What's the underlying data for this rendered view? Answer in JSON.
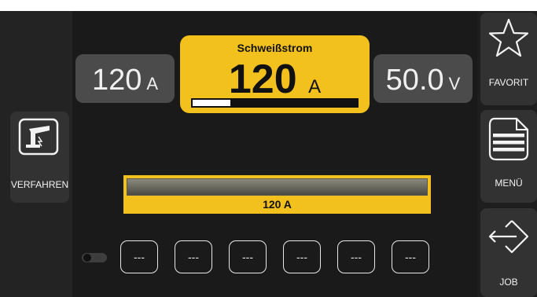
{
  "left_panel": {
    "process_label": "VERFAHREN",
    "process_icon": "welding-torch-icon"
  },
  "right_panel": {
    "favorite_label": "FAVORIT",
    "favorite_icon": "star-icon",
    "menu_label": "MENÜ",
    "menu_icon": "document-lines-icon",
    "job_label": "JOB",
    "job_icon": "diamond-arrow-icon"
  },
  "params": {
    "left_value": "120",
    "left_unit": "A",
    "right_value": "50.0",
    "right_unit": "V"
  },
  "current": {
    "title": "Schweißstrom",
    "value": "120",
    "unit": "A",
    "level": 0.23,
    "accent_color": "#f3c11d"
  },
  "bar": {
    "label": "120 A"
  },
  "toggle": {
    "state": "off"
  },
  "slots": [
    "---",
    "---",
    "---",
    "---",
    "---",
    "---"
  ]
}
